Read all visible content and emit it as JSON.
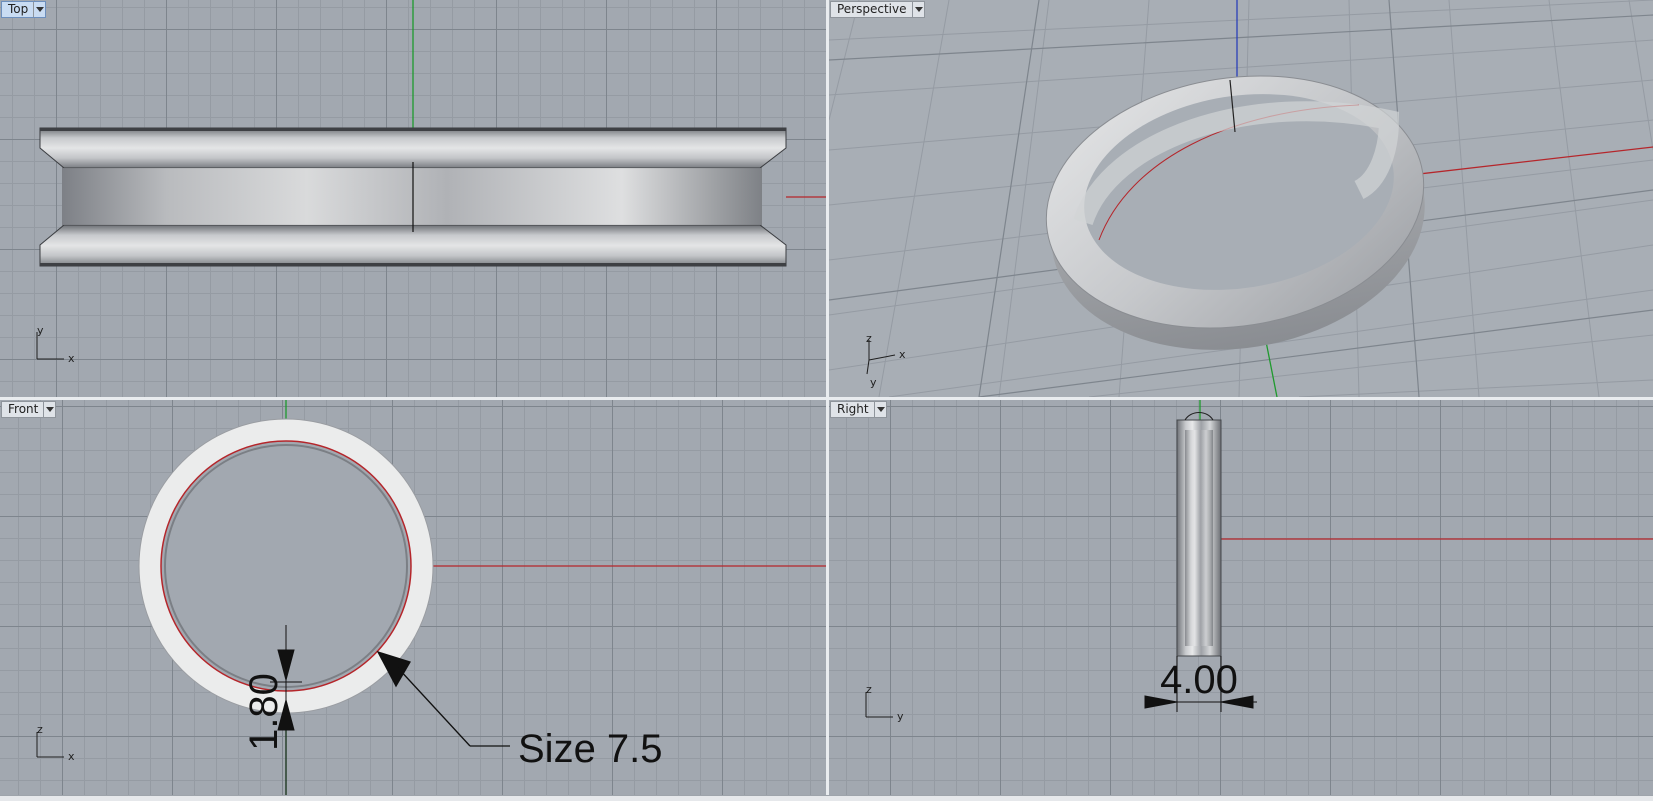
{
  "viewports": {
    "top": {
      "label": "Top",
      "axis_a": "y",
      "axis_b": "x"
    },
    "perspective": {
      "label": "Perspective",
      "axis_a": "z",
      "axis_b": "x",
      "axis_c": "y"
    },
    "front": {
      "label": "Front",
      "axis_a": "z",
      "axis_b": "x"
    },
    "right": {
      "label": "Right",
      "axis_a": "z",
      "axis_b": "y"
    }
  },
  "annotations": {
    "thickness": "1.80",
    "ring_size": "Size 7.5",
    "width": "4.00"
  },
  "colors": {
    "viewport_bg": "#a2a8b0",
    "x_axis": "#b5262b",
    "y_axis": "#1f9a2e",
    "z_axis": "#2b3fb8",
    "active_tab": "#c9dcf3"
  }
}
